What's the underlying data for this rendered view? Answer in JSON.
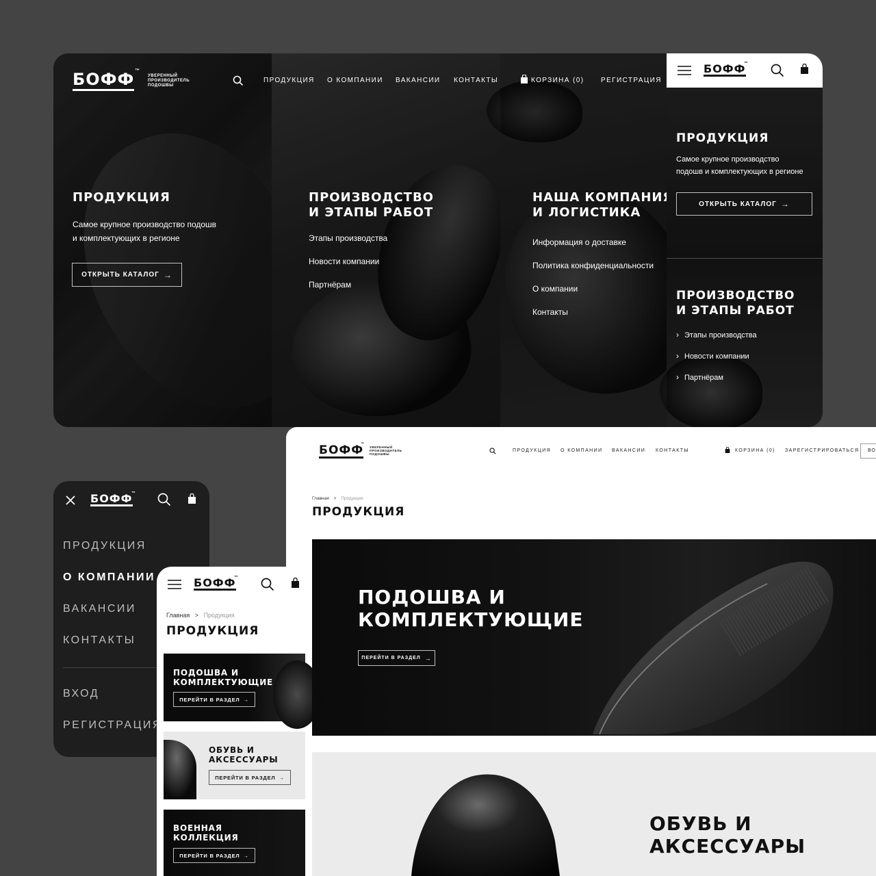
{
  "brand": {
    "name": "БОФФ",
    "tm": "™",
    "tagline_lines": [
      "Уверенный",
      "производитель",
      "подошвы"
    ]
  },
  "desktop_dark": {
    "nav": [
      "Продукция",
      "О компании",
      "Вакансии",
      "Контакты"
    ],
    "cart": "Корзина (0)",
    "register": "Регистрация",
    "col1": {
      "title": "Продукция",
      "desc_lines": [
        "Самое крупное производство подошв",
        "и комплектующих в регионе"
      ],
      "button": "Открыть каталог"
    },
    "col2": {
      "title_lines": [
        "Производство",
        "и этапы работ"
      ],
      "links": [
        "Этапы производства",
        "Новости компании",
        "Партнёрам"
      ]
    },
    "col3": {
      "title_lines": [
        "Наша компания",
        "и логистика"
      ],
      "links": [
        "Информация о доставке",
        "Политика конфиденциальности",
        "О компании",
        "Контакты"
      ]
    }
  },
  "mobile_dark": {
    "section1": {
      "title": "Продукция",
      "desc_lines": [
        "Самое крупное производство",
        "подошв и комплектующих в регионе"
      ],
      "button": "Открыть каталог"
    },
    "section2": {
      "title_lines": [
        "Производство",
        "и этапы работ"
      ],
      "links": [
        "Этапы производства",
        "Новости компании",
        "Партнёрам"
      ]
    }
  },
  "desktop_white": {
    "nav": [
      "Продукция",
      "О компании",
      "Вакансии",
      "Контакты"
    ],
    "cart": "Корзина (0)",
    "register": "Зарегистрироваться",
    "login_partial": "Во",
    "breadcrumb": {
      "home": "Главная",
      "sep": ">",
      "current": "Продукция"
    },
    "page_title": "Продукция",
    "banner1": {
      "title_lines": [
        "Подошва и",
        "комплектующие"
      ],
      "button": "Перейти в раздел"
    },
    "banner2": {
      "title_lines": [
        "Обувь и",
        "аксессуары"
      ]
    }
  },
  "mobile_menu": {
    "items": [
      "Продукция",
      "О компании",
      "Вакансии",
      "Контакты"
    ],
    "active_index": 1,
    "login": "Вход",
    "register": "Регистрация"
  },
  "mobile_white": {
    "breadcrumb": {
      "home": "Главная",
      "sep": ">",
      "current": "Продукция"
    },
    "page_title": "Продукция",
    "cards": [
      {
        "title_lines": [
          "Подошва и",
          "комплектующие"
        ],
        "button": "Перейти в раздел"
      },
      {
        "title_lines": [
          "Обувь и",
          "аксессуары"
        ],
        "button": "Перейти в раздел"
      },
      {
        "title_lines": [
          "Военная",
          "коллекция"
        ],
        "button": "Перейти в раздел"
      }
    ]
  },
  "icons": [
    "search-icon",
    "cart-icon",
    "menu-icon",
    "close-icon",
    "arrow-right-icon",
    "chevron-right-icon"
  ],
  "colors": {
    "background": "#444444",
    "dark": "#111111",
    "white": "#ffffff",
    "light_gray": "#ebebeb"
  }
}
